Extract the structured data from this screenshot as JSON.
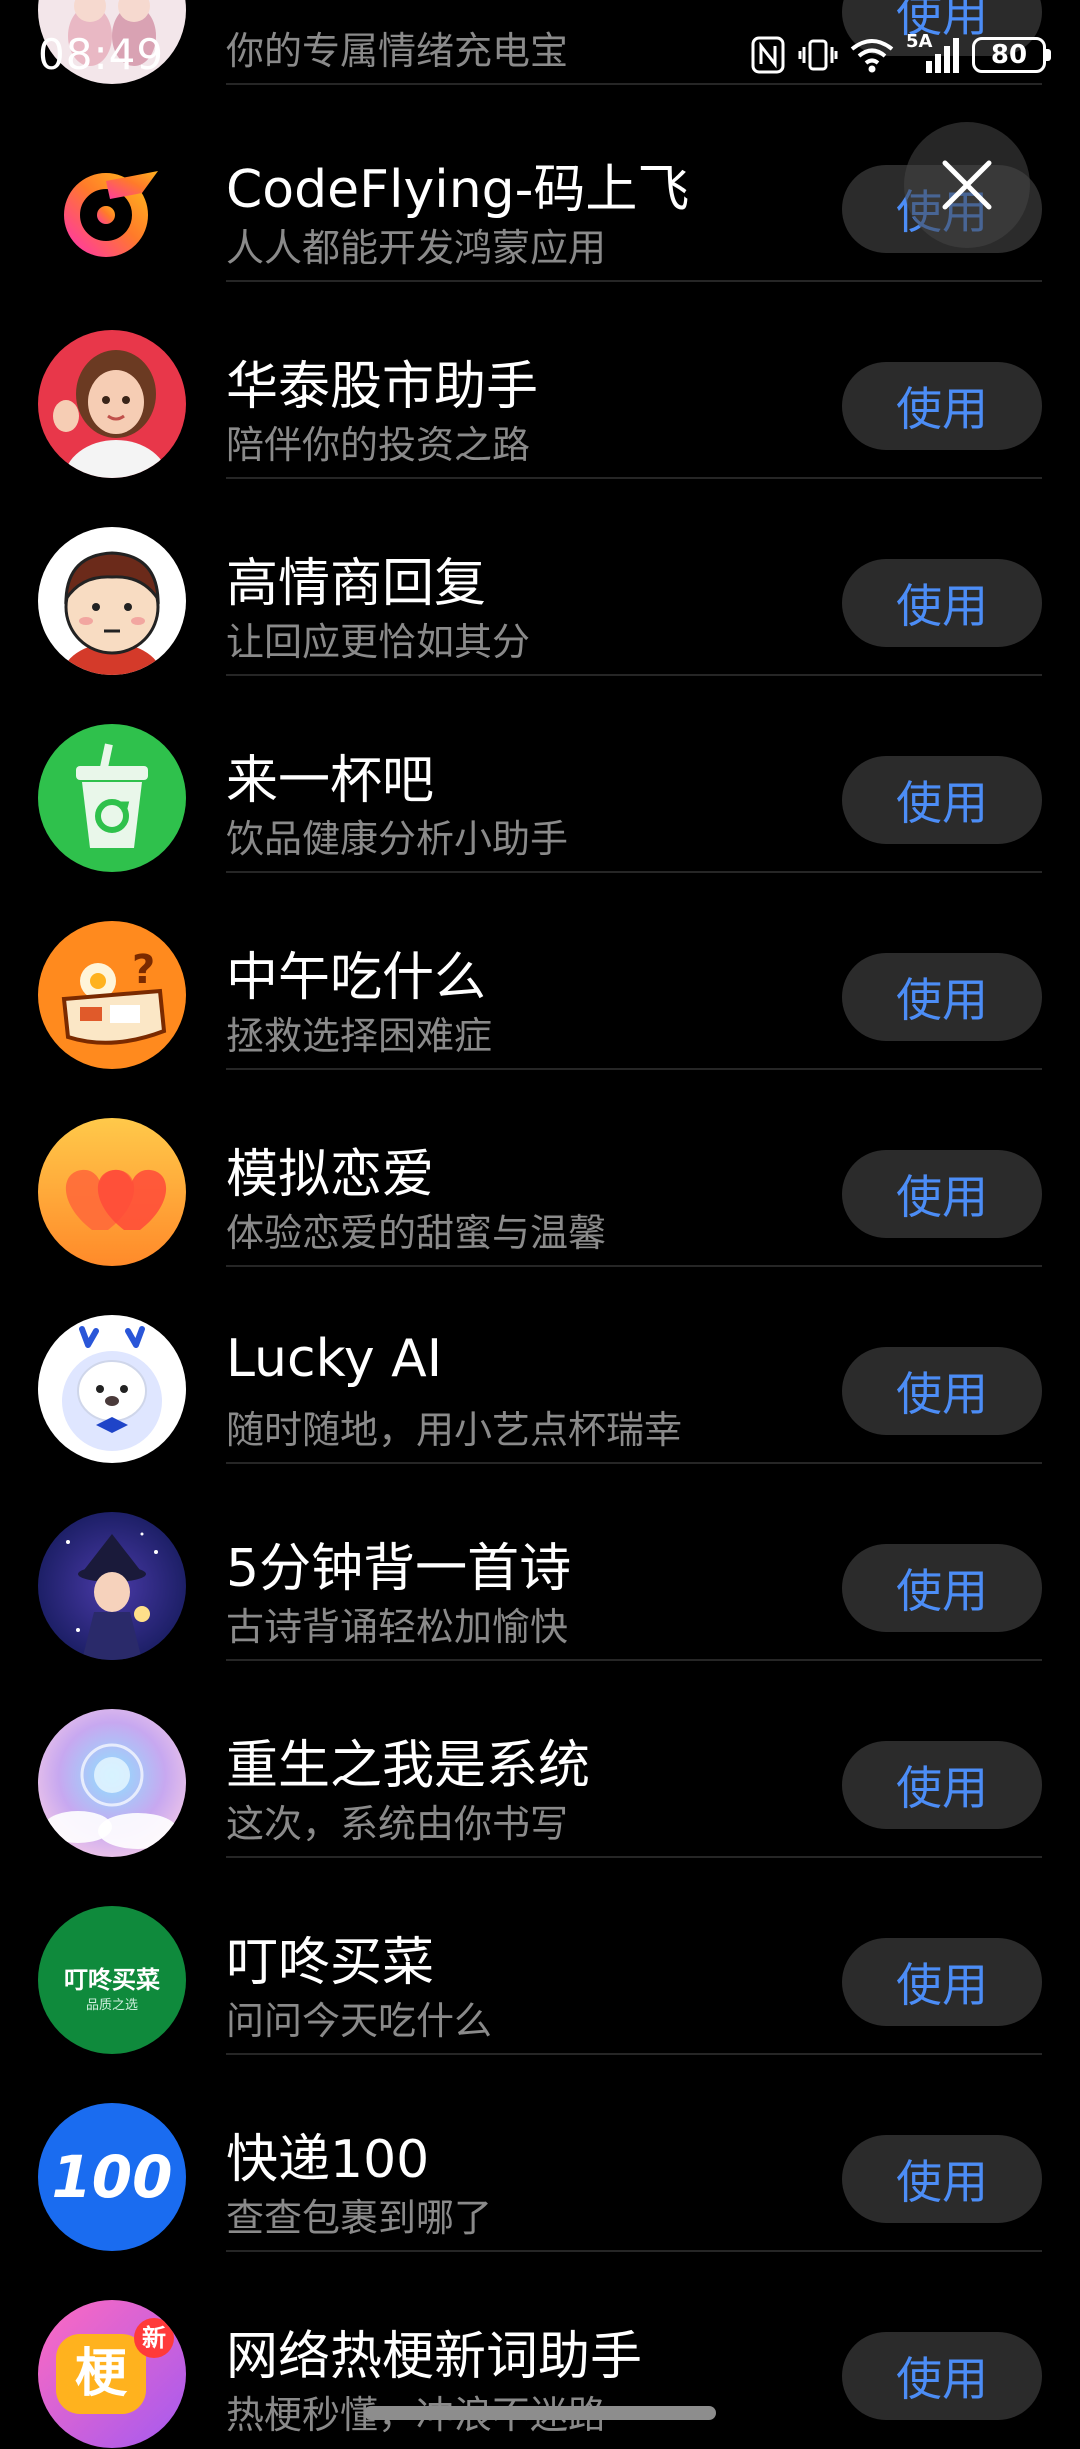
{
  "status_bar": {
    "time": "08:49",
    "battery": "80",
    "network": "5A"
  },
  "close_button_icon": "close-icon",
  "use_label": "使用",
  "items": [
    {
      "title": "",
      "subtitle": "你的专属情绪充电宝",
      "icon": "emotion-avatar"
    },
    {
      "title": "CodeFlying-码上飞",
      "subtitle": "人人都能开发鸿蒙应用",
      "icon": "codeflying-logo"
    },
    {
      "title": "华泰股市助手",
      "subtitle": "陪伴你的投资之路",
      "icon": "waving-girl-avatar"
    },
    {
      "title": "高情商回复",
      "subtitle": "让回应更恰如其分",
      "icon": "cartoon-boy-avatar"
    },
    {
      "title": "来一杯吧",
      "subtitle": "饮品健康分析小助手",
      "icon": "drink-cup-icon"
    },
    {
      "title": "中午吃什么",
      "subtitle": "拯救选择困难症",
      "icon": "lunchbox-icon"
    },
    {
      "title": "模拟恋爱",
      "subtitle": "体验恋爱的甜蜜与温馨",
      "icon": "hearts-icon"
    },
    {
      "title": "Lucky AI",
      "subtitle": "随时随地，用小艺点杯瑞幸",
      "icon": "deer-mascot-icon"
    },
    {
      "title": "5分钟背一首诗",
      "subtitle": "古诗背诵轻松加愉快",
      "icon": "poet-girl-avatar"
    },
    {
      "title": "重生之我是系统",
      "subtitle": "这次，系统由你书写",
      "icon": "dreamy-cloud-icon"
    },
    {
      "title": "叮咚买菜",
      "subtitle": "问问今天吃什么",
      "icon": "dingdong-logo",
      "logo_text": "叮咚买菜",
      "logo_sub": "品质之选"
    },
    {
      "title": "快递100",
      "subtitle": "查查包裹到哪了",
      "icon": "kuaidi100-logo",
      "logo_text": "100"
    },
    {
      "title": "网络热梗新词助手",
      "subtitle": "热梗秒懂，冲浪不迷路",
      "icon": "geng-badge-icon",
      "logo_text": "梗",
      "badge_text": "新"
    }
  ]
}
